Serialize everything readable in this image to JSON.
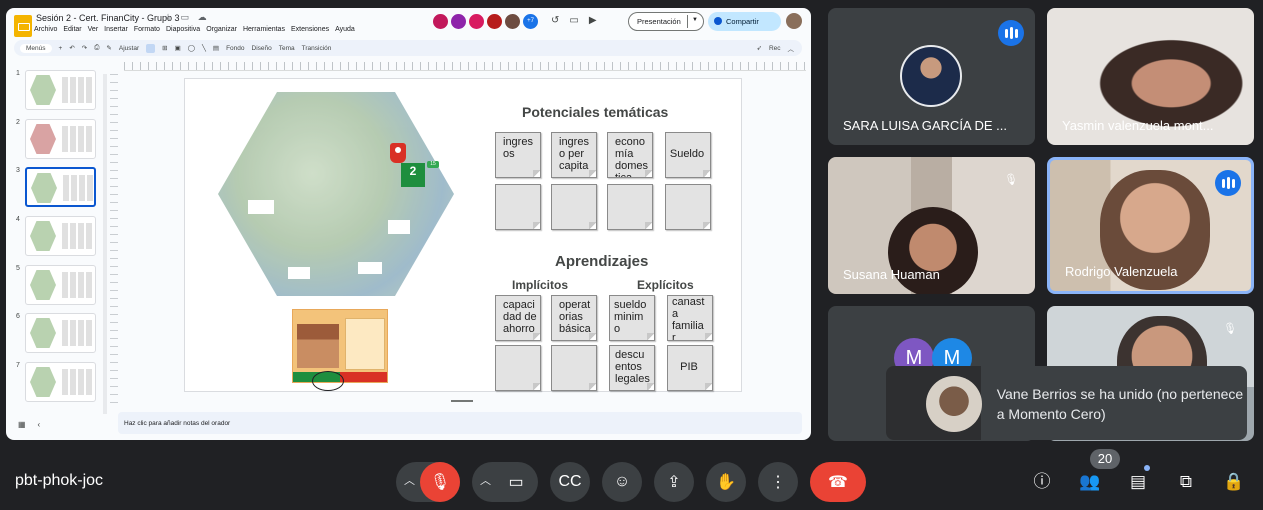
{
  "slides": {
    "doc_title": "Sesión 2 - Cert. FinanCity - Grupo 3",
    "menu": [
      "Archivo",
      "Editar",
      "Ver",
      "Insertar",
      "Formato",
      "Diapositiva",
      "Organizar",
      "Herramientas",
      "Extensiones",
      "Ayuda"
    ],
    "collab_count": "+7",
    "present_label": "Presentación",
    "share_label": "Compartir",
    "toolbar": {
      "search": "Menús",
      "zoom": "Ajustar",
      "fondo": "Fondo",
      "diseno": "Diseño",
      "tema": "Tema",
      "transicion": "Transición",
      "rec": "Rec"
    },
    "thumbnails": [
      "1",
      "2",
      "3",
      "4",
      "5",
      "6",
      "7"
    ],
    "active_slide": 3,
    "speaker_notes_placeholder": "Haz clic para añadir notas del orador",
    "slide": {
      "marker_number": "2",
      "marker_badge": "15",
      "potenciales_title": "Potenciales temáticas",
      "potenciales_notes": [
        "ingres os",
        "ingres o per capita",
        "econo mía domes tica",
        "Sueldo"
      ],
      "aprendizajes_title": "Aprendizajes",
      "implicitos_label": "Implícitos",
      "explicitos_label": "Explícitos",
      "aprendizajes_notes": [
        "capaci dad de ahorro",
        "operat orias básica",
        "sueldo minim o",
        "canast a familia r",
        "descu entos legales",
        "PIB"
      ]
    }
  },
  "participants": [
    {
      "name": "SARA LUISA GARCÍA DE ...",
      "speaking": true
    },
    {
      "name": "Yasmin valenzuela mont...",
      "speaking": false
    },
    {
      "name": "Susana Huaman",
      "muted": true
    },
    {
      "name": "Rodrigo Valenzuela",
      "speaking": true
    },
    {
      "name": "",
      "avatars": [
        "M",
        "M"
      ]
    },
    {
      "name": "",
      "muted": true
    }
  ],
  "toast": {
    "message": "Vane Berrios se ha unido (no pertenece a Momento Cero)"
  },
  "meeting": {
    "code": "pbt-phok-joc",
    "participant_count": "20"
  },
  "colors": {
    "end_call": "#ea4335",
    "accent_blue": "#1a73e8",
    "share_bg": "#c2e7ff"
  }
}
